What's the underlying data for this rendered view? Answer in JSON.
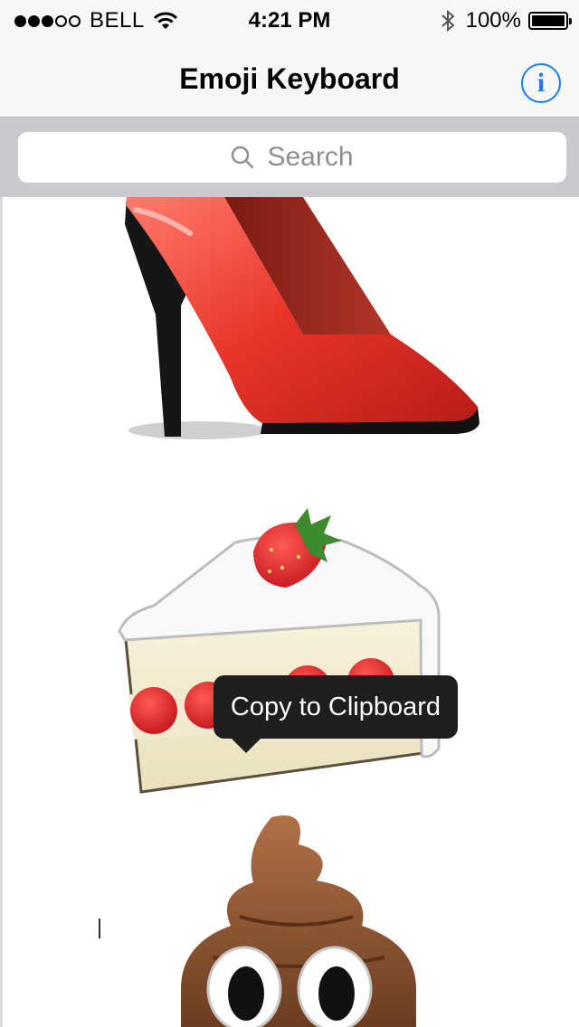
{
  "status_bar": {
    "carrier": "BELL",
    "signal_strength": "3 of 5",
    "time": "4:21 PM",
    "battery_percent": "100%",
    "battery_level": 1.0,
    "icons": [
      "wifi-icon",
      "bluetooth-icon",
      "battery-icon"
    ]
  },
  "nav_bar": {
    "title": "Emoji Keyboard",
    "info_icon_glyph": "i",
    "accent_color": "#1a7cf4"
  },
  "search": {
    "placeholder": "Search",
    "icon": "search-icon"
  },
  "emoji_list": [
    {
      "name": "high-heeled-shoe"
    },
    {
      "name": "shortcake"
    },
    {
      "name": "pile-of-poo"
    }
  ],
  "tooltip": {
    "label": "Copy to Clipboard"
  }
}
